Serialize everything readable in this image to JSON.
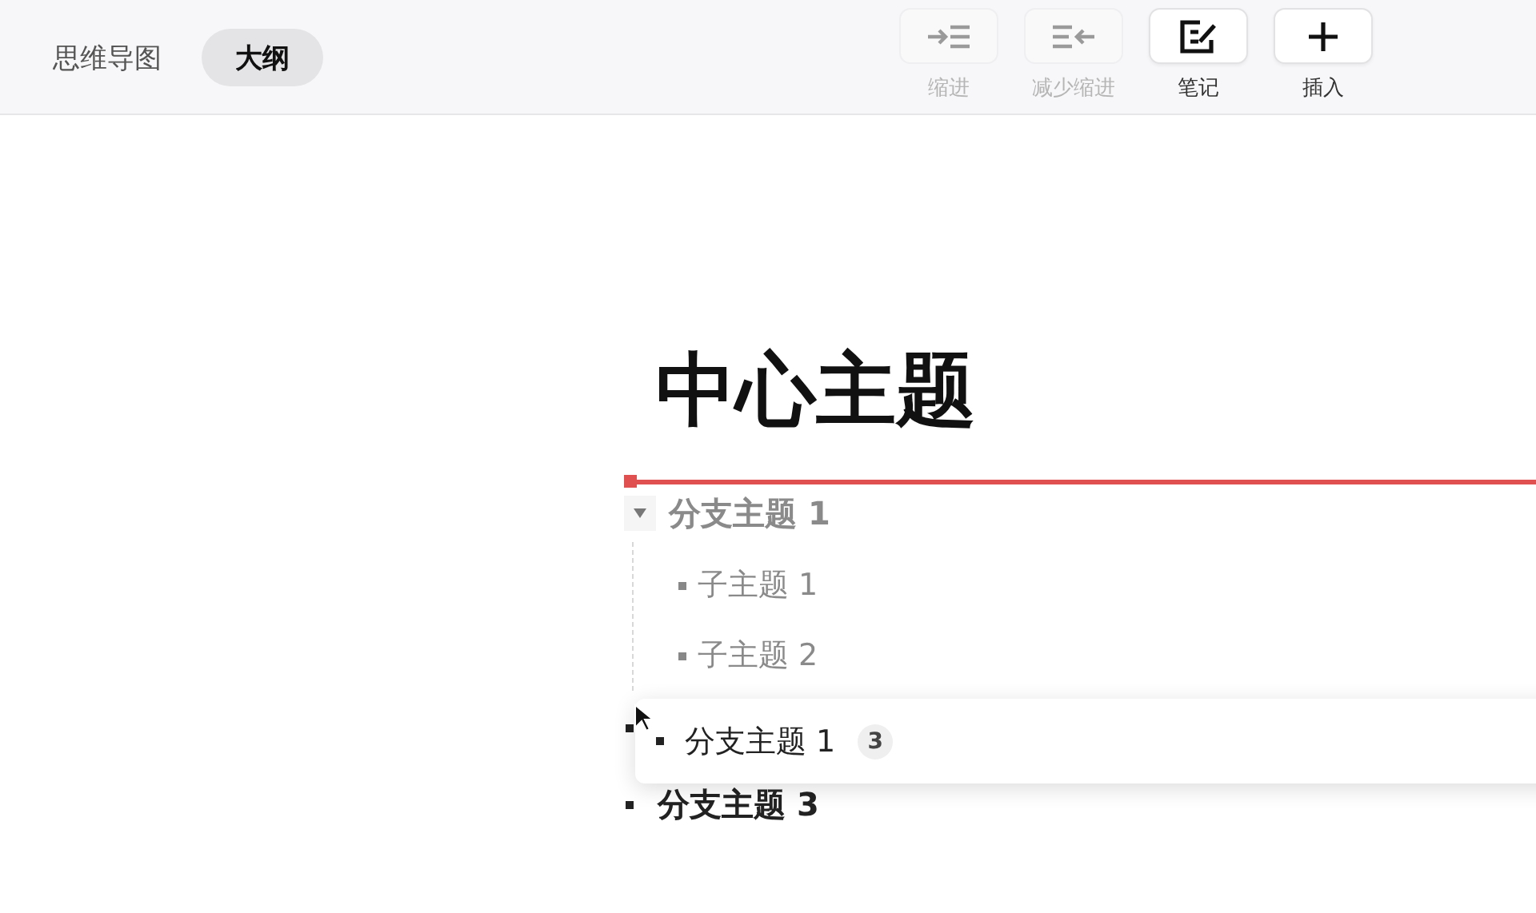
{
  "view_tabs": [
    {
      "label": "思维导图",
      "selected": false
    },
    {
      "label": "大纲",
      "selected": true
    }
  ],
  "toolbar": [
    {
      "kind": "indent",
      "label": "缩进",
      "disabled": true
    },
    {
      "kind": "outdent",
      "label": "减少缩进",
      "disabled": true
    },
    {
      "kind": "note",
      "label": "笔记",
      "disabled": false
    },
    {
      "kind": "insert",
      "label": "插入",
      "disabled": false
    }
  ],
  "outline": {
    "title": "中心主题",
    "branches": [
      {
        "kind": "topic",
        "label": "分支主题 1",
        "dragging": true,
        "expanded": true,
        "children": [
          {
            "label": "子主题 1"
          },
          {
            "label": "子主题 2"
          }
        ]
      },
      {
        "kind": "covered"
      },
      {
        "kind": "topic",
        "label": "分支主题 3",
        "dragging": false
      }
    ]
  },
  "drag_preview": {
    "label": "分支主题 1",
    "count": "3"
  }
}
